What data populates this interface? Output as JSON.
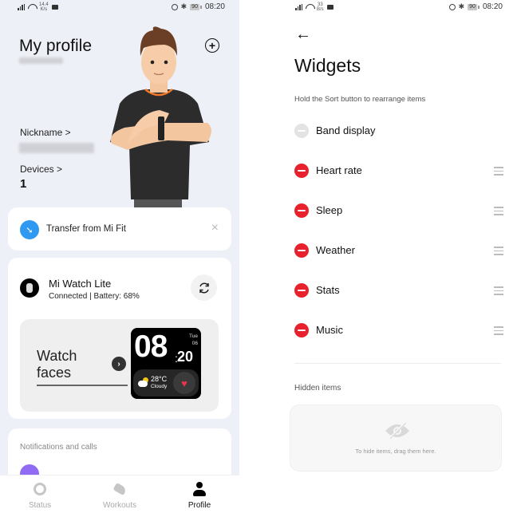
{
  "left_screen": {
    "status_bar": {
      "net_speed_value": "14.4",
      "net_speed_unit": "K/s",
      "battery": "90",
      "time": "08:20"
    },
    "header": {
      "title": "My profile",
      "add_icon": "plus-circle-icon"
    },
    "profile": {
      "nickname_label": "Nickname >",
      "devices_label": "Devices >",
      "devices_count": "1"
    },
    "transfer_card": {
      "text": "Transfer from Mi Fit",
      "icon": "arrow-turn-icon",
      "close_icon": "×"
    },
    "device_card": {
      "name": "Mi Watch Lite",
      "status": "Connected | Battery: 68%",
      "battery_percent": 68,
      "sync_icon": "sync-icon",
      "watch_faces_label": "Watch faces",
      "watch_face_preview": {
        "hour": "08",
        "minute": "20",
        "colon": ":",
        "day": "Tue",
        "date": "06",
        "temperature": "28°C",
        "condition": "Cloudy",
        "heart_icon": "♥"
      }
    },
    "notifications_card": {
      "title": "Notifications and calls"
    },
    "bottom_nav": {
      "items": [
        {
          "label": "Status",
          "icon": "ring-icon",
          "active": false
        },
        {
          "label": "Workouts",
          "icon": "shoe-icon",
          "active": false
        },
        {
          "label": "Profile",
          "icon": "person-icon",
          "active": true
        }
      ]
    }
  },
  "right_screen": {
    "status_bar": {
      "net_speed_value": "33",
      "net_speed_unit": "B/s",
      "battery": "90",
      "time": "08:20"
    },
    "back_icon": "←",
    "title": "Widgets",
    "hint": "Hold the Sort button to rearrange items",
    "items": [
      {
        "label": "Band display",
        "removable": false,
        "sortable": false
      },
      {
        "label": "Heart rate",
        "removable": true,
        "sortable": true
      },
      {
        "label": "Sleep",
        "removable": true,
        "sortable": true
      },
      {
        "label": "Weather",
        "removable": true,
        "sortable": true
      },
      {
        "label": "Stats",
        "removable": true,
        "sortable": true
      },
      {
        "label": "Music",
        "removable": true,
        "sortable": true
      }
    ],
    "hidden_section": {
      "title": "Hidden items",
      "empty_hint": "To hide items, drag them here."
    }
  },
  "colors": {
    "accent_red": "#e8222c",
    "transfer_blue": "#2f98f1",
    "heart_red": "#e8344b",
    "notification_purple": "#8f6cf2",
    "profile_bg": "#eef0f7"
  }
}
